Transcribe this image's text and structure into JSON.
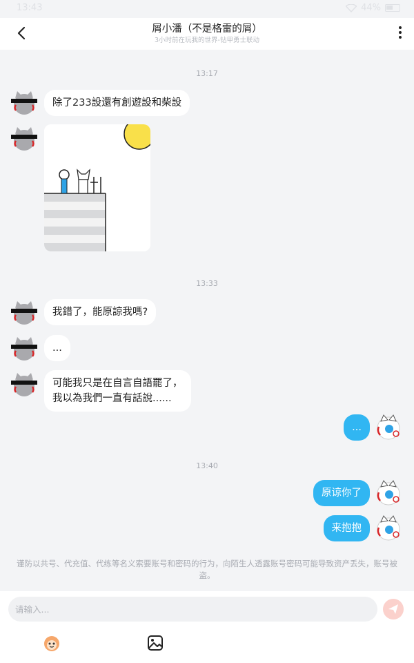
{
  "status": {
    "time": "13:43",
    "battery": "44%"
  },
  "header": {
    "title": "屑小潘（不是格雷的屑）",
    "subtitle": "3小时前在玩我的世界-钻甲勇士联动"
  },
  "chat": {
    "timestamps": [
      "13:17",
      "13:33",
      "13:40"
    ],
    "messages": [
      "除了233設還有創遊設和柴設",
      "我錯了，能原諒我嗎?",
      "...",
      "可能我只是在自言自語罷了，\n我以為我們一直有話說......",
      "...",
      "原谅你了",
      "来抱抱"
    ]
  },
  "notice": "谨防以共号、代充值、代练等名义索要账号和密码的行为，向陌生人透露账号密码可能导致资产丢失，账号被盗。",
  "input": {
    "placeholder": "请输入..."
  },
  "icons": {
    "back": "chevron-left-icon",
    "more": "more-vertical-icon",
    "send": "send-icon",
    "emoji": "sticker-emoji-icon",
    "image": "image-icon"
  },
  "colors": {
    "my_bubble": "#31b6f2",
    "send_button": "#fbd1cc"
  }
}
